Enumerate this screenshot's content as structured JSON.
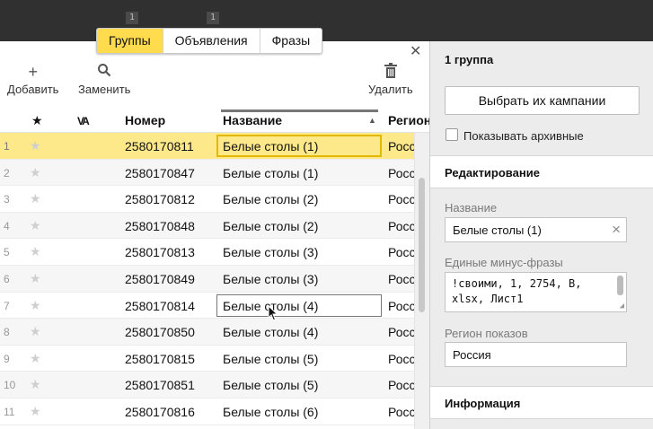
{
  "top": {
    "tabs": [
      {
        "label": "Группы",
        "active": true
      },
      {
        "label": "Объявления",
        "active": false
      },
      {
        "label": "Фразы",
        "active": false
      }
    ],
    "tab_badges": [
      "1",
      "1"
    ]
  },
  "toolbar": {
    "add_label": "Добавить",
    "replace_label": "Заменить",
    "delete_label": "Удалить",
    "close_glyph": "✕"
  },
  "table": {
    "columns": {
      "star": "★",
      "flag": "VA",
      "number": "Номер",
      "name": "Название",
      "region": "Регион"
    },
    "rows": [
      {
        "idx": "1",
        "number": "2580170811",
        "name": "Белые столы (1)",
        "region": "Россия"
      },
      {
        "idx": "2",
        "number": "2580170847",
        "name": "Белые столы (1)",
        "region": "Россия"
      },
      {
        "idx": "3",
        "number": "2580170812",
        "name": "Белые столы (2)",
        "region": "Россия"
      },
      {
        "idx": "4",
        "number": "2580170848",
        "name": "Белые столы (2)",
        "region": "Россия"
      },
      {
        "idx": "5",
        "number": "2580170813",
        "name": "Белые столы (3)",
        "region": "Россия"
      },
      {
        "idx": "6",
        "number": "2580170849",
        "name": "Белые столы (3)",
        "region": "Россия"
      },
      {
        "idx": "7",
        "number": "2580170814",
        "name": "Белые столы (4)",
        "region": "Россия"
      },
      {
        "idx": "8",
        "number": "2580170850",
        "name": "Белые столы (4)",
        "region": "Россия"
      },
      {
        "idx": "9",
        "number": "2580170815",
        "name": "Белые столы (5)",
        "region": "Россия"
      },
      {
        "idx": "10",
        "number": "2580170851",
        "name": "Белые столы (5)",
        "region": "Россия"
      },
      {
        "idx": "11",
        "number": "2580170816",
        "name": "Белые столы (6)",
        "region": "Россия"
      }
    ],
    "selected_row": 0,
    "hover_row": 6
  },
  "side": {
    "title": "1 группа",
    "choose_campaigns_button": "Выбрать их кампании",
    "show_archived_label": "Показывать архивные",
    "editing_header": "Редактирование",
    "name_label": "Название",
    "name_value": "Белые столы (1)",
    "minus_phrases_label": "Единые минус-фразы",
    "minus_phrases_value": "!своими, 1, 2754, В, xlsx, Лист1",
    "region_label": "Регион показов",
    "region_value": "Россия",
    "info_header": "Информация"
  },
  "colors": {
    "accent_yellow": "#ffdb4d",
    "selected_row": "#fde98a",
    "selected_border": "#e2b800"
  }
}
